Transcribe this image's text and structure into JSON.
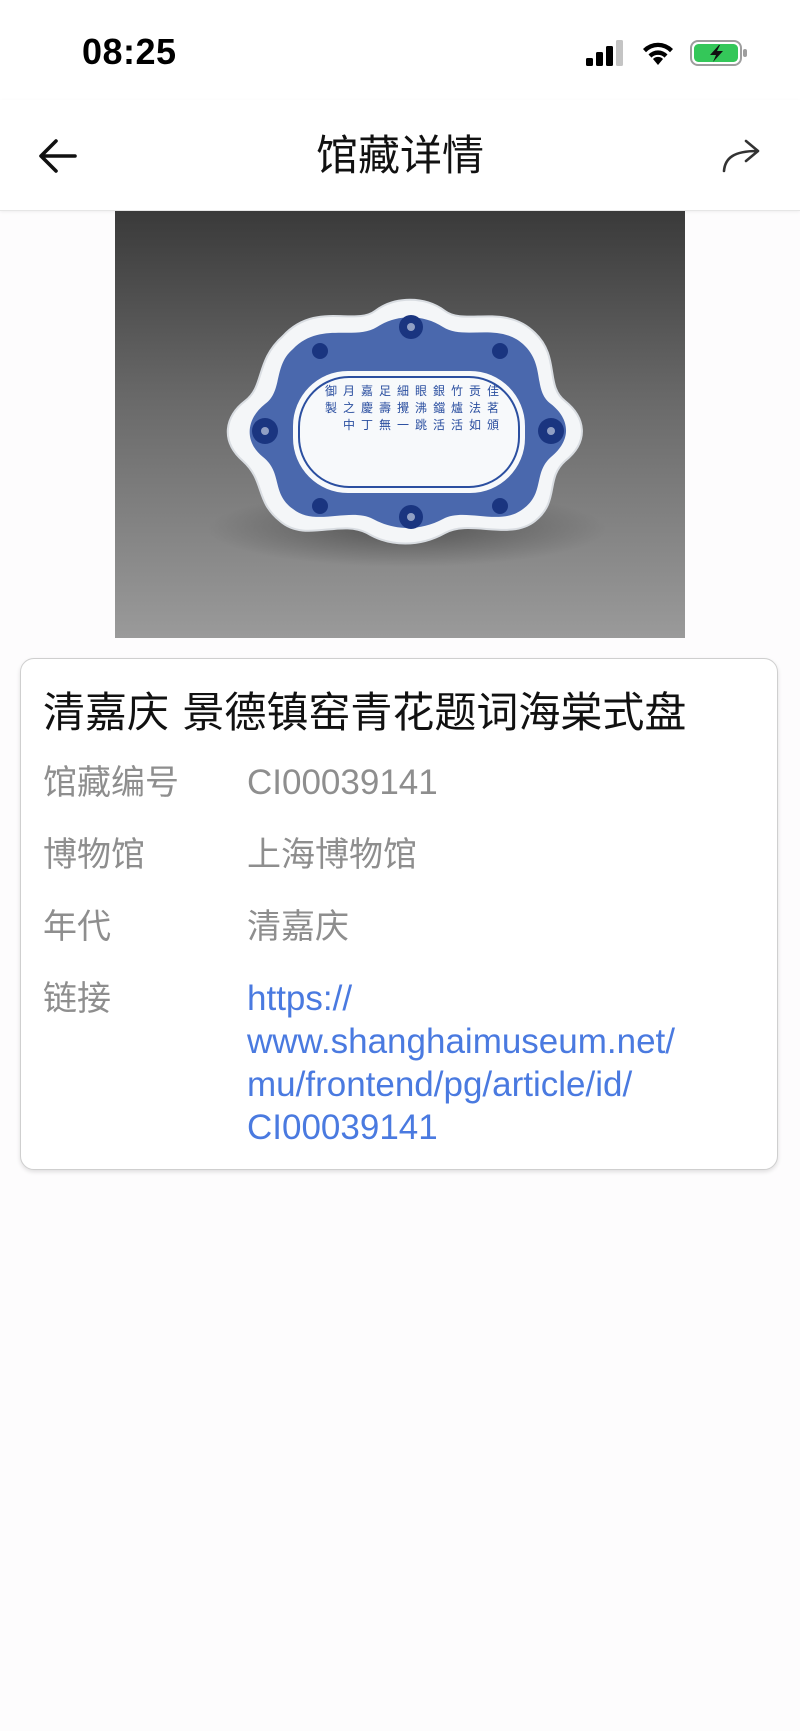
{
  "status_bar": {
    "time": "08:25",
    "icons": [
      "signal-icon",
      "wifi-icon",
      "battery-charging-icon"
    ]
  },
  "nav": {
    "title": "馆藏详情",
    "back_icon": "back-arrow-icon",
    "share_icon": "share-icon"
  },
  "artwork": {
    "inscription_columns": [
      "佳茗頒",
      "贡法如",
      "竹爐活",
      "銀鐺活",
      "眼沸跳",
      "細攪一",
      "足壽無",
      "嘉慶丁",
      "月之中",
      "御製"
    ]
  },
  "detail": {
    "title": "清嘉庆 景德镇窑青花题词海棠式盘",
    "rows": [
      {
        "label": "馆藏编号",
        "value": "CI00039141"
      },
      {
        "label": "博物馆",
        "value": "上海博物馆"
      },
      {
        "label": "年代",
        "value": "清嘉庆"
      }
    ],
    "link_label": "链接",
    "link_lines": [
      "https://",
      "www.shanghaimuseum.net/",
      "mu/frontend/pg/article/id/",
      "CI00039141"
    ]
  },
  "colors": {
    "link": "#4a7ae0",
    "label": "#8e8e8e",
    "battery": "#34c759",
    "porcelain_blue": "#1f3f8f"
  }
}
